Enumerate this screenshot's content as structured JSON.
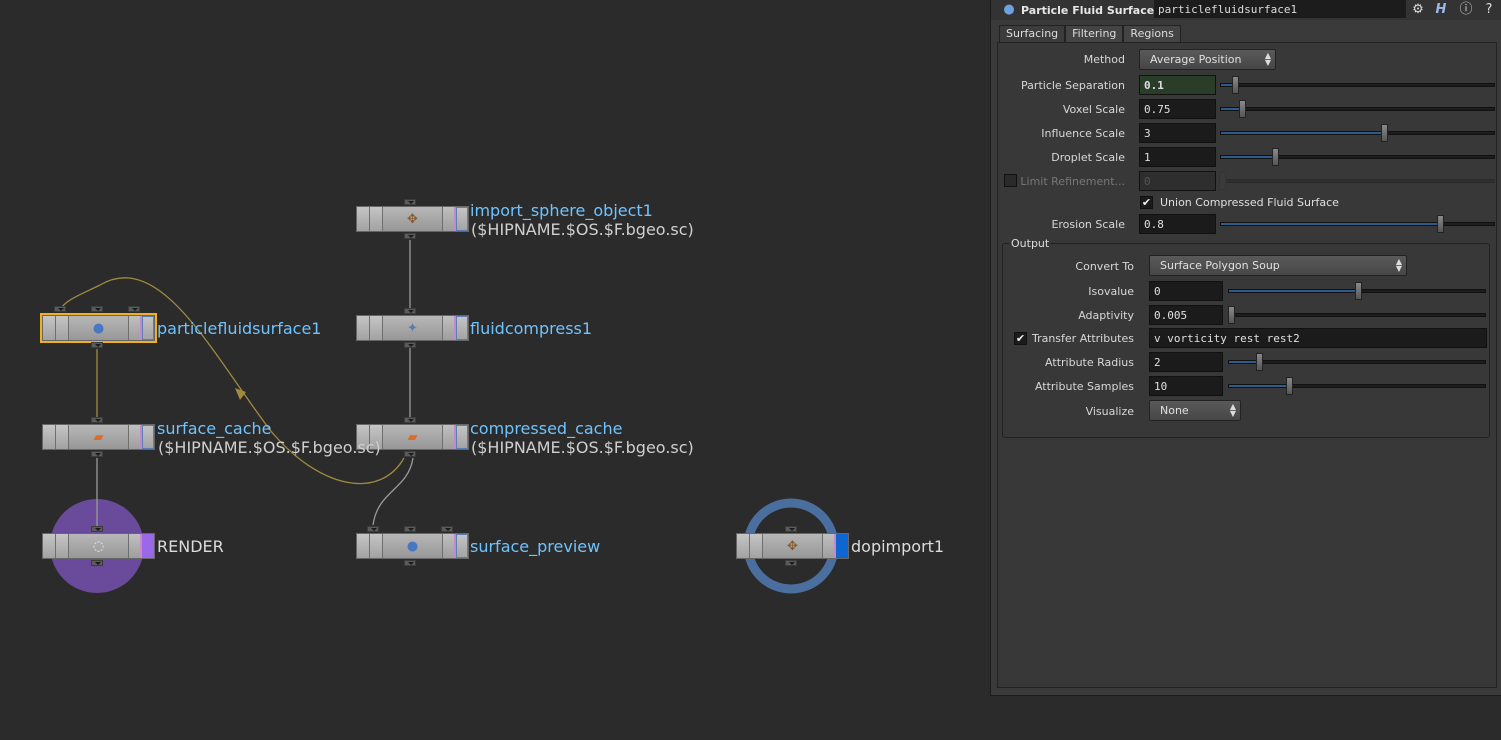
{
  "network": {
    "nodes": {
      "import_sphere": {
        "name": "import_sphere_object1",
        "sub": "($HIPNAME.$OS.$F.bgeo.sc)"
      },
      "fluidcompress": {
        "name": "fluidcompress1"
      },
      "compressed_cache": {
        "name": "compressed_cache",
        "sub": "($HIPNAME.$OS.$F.bgeo.sc)"
      },
      "surface_preview": {
        "name": "surface_preview"
      },
      "particlefluidsurface": {
        "name": "particlefluidsurface1"
      },
      "surface_cache": {
        "name": "surface_cache",
        "sub": "($HIPNAME.$OS.$F.bgeo.sc)"
      },
      "render": {
        "name": "RENDER"
      },
      "dopimport": {
        "name": "dopimport1"
      }
    }
  },
  "panel": {
    "node_type": "Particle Fluid Surface",
    "node_name": "particlefluidsurface1",
    "tabs": [
      "Surfacing",
      "Filtering",
      "Regions"
    ],
    "params": {
      "method_label": "Method",
      "method_value": "Average Position",
      "particle_separation_label": "Particle Separation",
      "particle_separation_value": "0.1",
      "voxel_scale_label": "Voxel Scale",
      "voxel_scale_value": "0.75",
      "influence_scale_label": "Influence Scale",
      "influence_scale_value": "3",
      "droplet_scale_label": "Droplet Scale",
      "droplet_scale_value": "1",
      "limit_refinement_label": "Limit Refinement...",
      "limit_refinement_value": "0",
      "union_label": "Union Compressed Fluid Surface",
      "erosion_scale_label": "Erosion Scale",
      "erosion_scale_value": "0.8"
    },
    "output": {
      "title": "Output",
      "convert_to_label": "Convert To",
      "convert_to_value": "Surface Polygon Soup",
      "isovalue_label": "Isovalue",
      "isovalue_value": "0",
      "adaptivity_label": "Adaptivity",
      "adaptivity_value": "0.005",
      "transfer_label": "Transfer Attributes",
      "transfer_value": "v vorticity rest rest2",
      "attr_radius_label": "Attribute Radius",
      "attr_radius_value": "2",
      "attr_samples_label": "Attribute Samples",
      "attr_samples_value": "10",
      "visualize_label": "Visualize",
      "visualize_value": "None"
    },
    "checkmark": "✔"
  },
  "colors": {
    "node_label": "#6fc3ff",
    "render_circle": "#6a4a9a",
    "dop_circle": "#4a6f9e",
    "selection": "#f0b020"
  }
}
